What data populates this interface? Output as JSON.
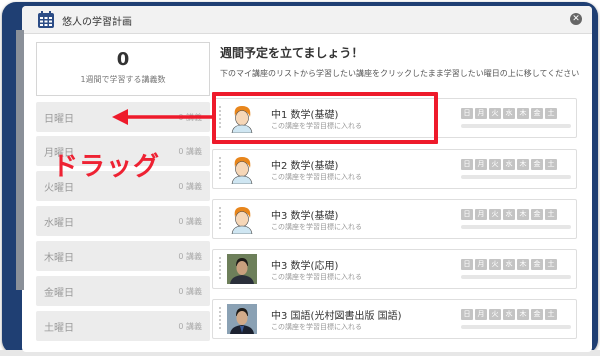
{
  "window": {
    "title": "悠人の学習計画",
    "close_glyph": "✕"
  },
  "summary": {
    "total": "0",
    "label": "1週間で学習する講義数"
  },
  "days": [
    {
      "name": "日曜日",
      "count": "0 講義"
    },
    {
      "name": "月曜日",
      "count": "0 講義"
    },
    {
      "name": "火曜日",
      "count": "0 講義"
    },
    {
      "name": "水曜日",
      "count": "0 講義"
    },
    {
      "name": "木曜日",
      "count": "0 講義"
    },
    {
      "name": "金曜日",
      "count": "0 講義"
    },
    {
      "name": "土曜日",
      "count": "0 講義"
    }
  ],
  "main": {
    "heading": "週間予定を立てましょう！",
    "instruction": "下のマイ講座のリストから学習したい講座をクリックしたまま学習したい曜日の上に移してください"
  },
  "weekday_labels": [
    "日",
    "月",
    "火",
    "水",
    "木",
    "金",
    "土"
  ],
  "courses": [
    {
      "name": "中1 数学(基礎)",
      "action": "この講座を学習目標に入れる",
      "avatar": "orange-hair-teacher",
      "progress": 0
    },
    {
      "name": "中2 数学(基礎)",
      "action": "この講座を学習目標に入れる",
      "avatar": "orange-hair-teacher",
      "progress": 0
    },
    {
      "name": "中3 数学(基礎)",
      "action": "この講座を学習目標に入れる",
      "avatar": "orange-hair-teacher",
      "progress": 0
    },
    {
      "name": "中3 数学(応用)",
      "action": "この講座を学習目標に入れる",
      "avatar": "photo-teacher-1",
      "progress": 0
    },
    {
      "name": "中3 国語(光村図書出版 国語)",
      "action": "この講座を学習目標に入れる",
      "avatar": "photo-teacher-2",
      "progress": 0
    }
  ],
  "annotation": {
    "drag_label": "ドラッグ",
    "color": "#ee1a2b"
  },
  "colors": {
    "frame": "#1f3f73",
    "day_pill": "#c4c4c4"
  }
}
